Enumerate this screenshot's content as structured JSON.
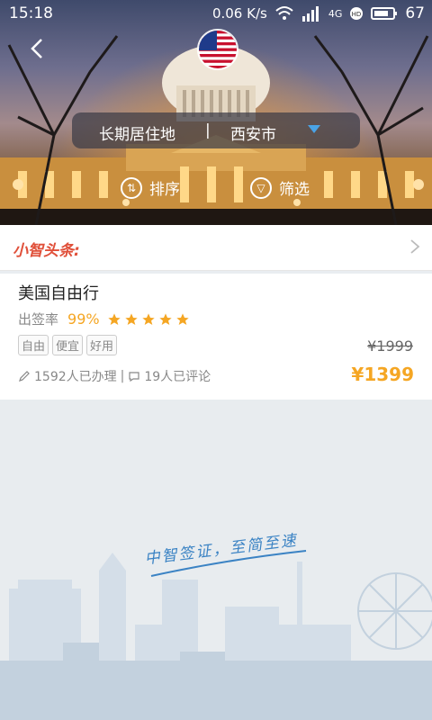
{
  "status": {
    "time": "15:18",
    "speed": "0.06 K/s",
    "network": "4G",
    "battery": "67"
  },
  "header": {
    "location_label": "长期居住地",
    "separator": "|",
    "city": "西安市",
    "sort_label": "排序",
    "filter_label": "筛选"
  },
  "news": {
    "title": "小智头条:"
  },
  "product": {
    "title": "美国自由行",
    "rate_label": "出签率",
    "rate_value": "99%",
    "stars": 5,
    "tags": [
      "自由",
      "便宜",
      "好用"
    ],
    "original_price": "¥1999",
    "price": "¥1399",
    "handled": "1592人已办理",
    "divider": "|",
    "comments": "19人已评论"
  },
  "banner": {
    "slogan": "中智签证，至简至速"
  },
  "colors": {
    "accent": "#f5a623",
    "news": "#e0503a",
    "slogan": "#3b83c4"
  }
}
